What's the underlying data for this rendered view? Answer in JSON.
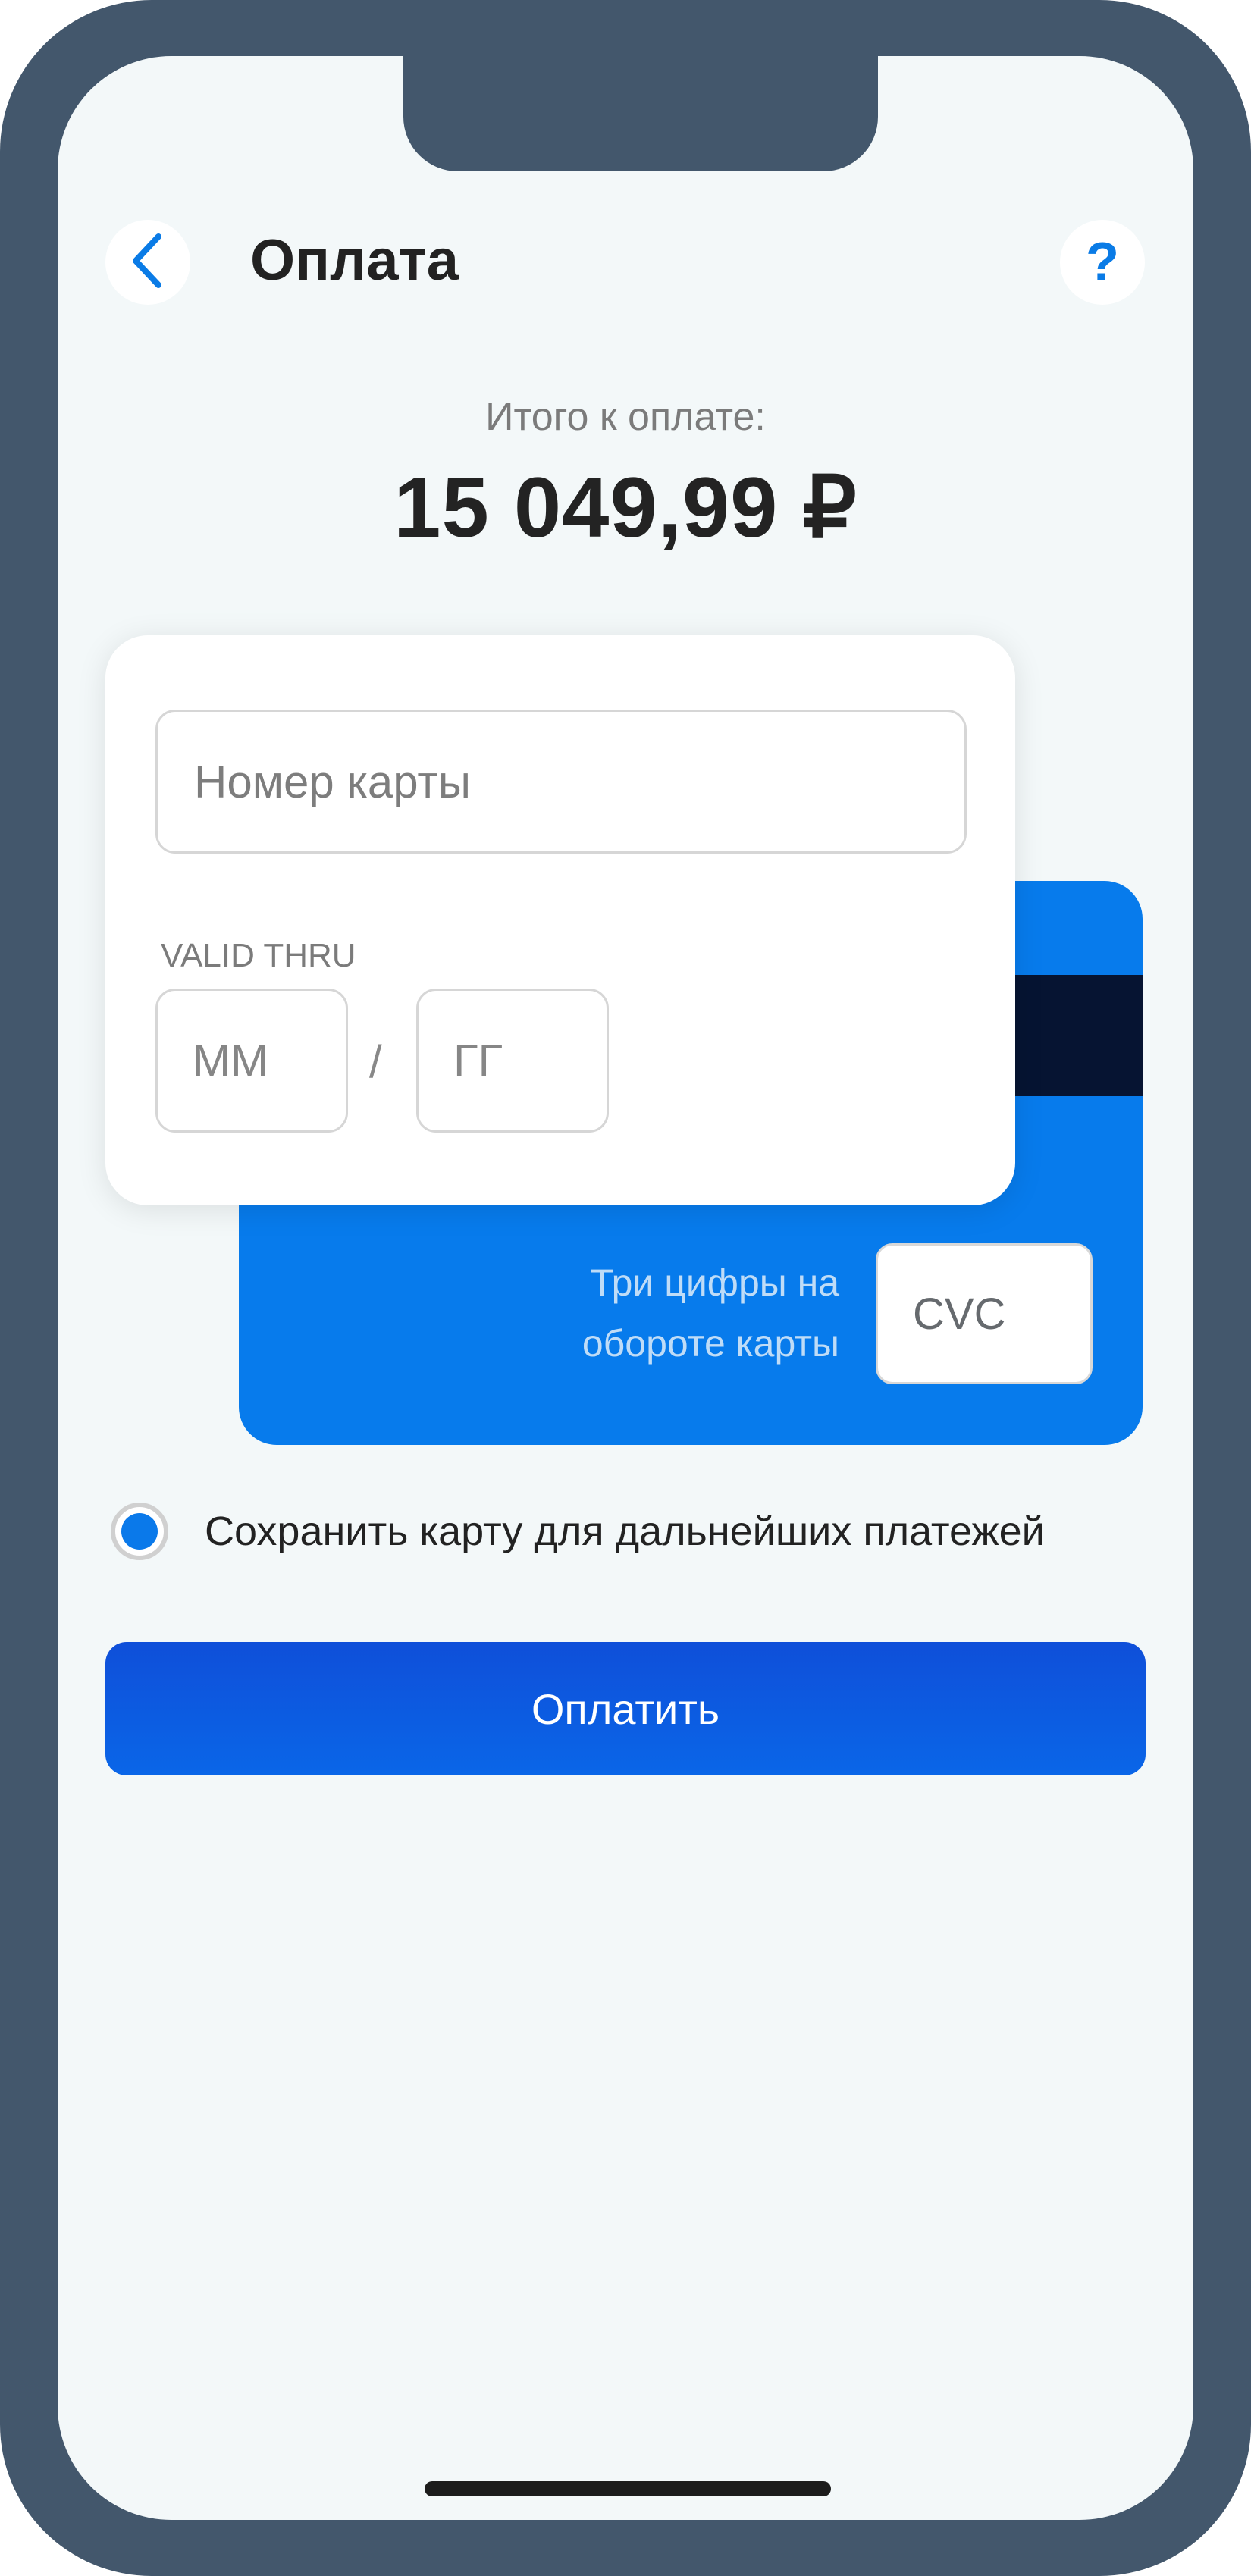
{
  "header": {
    "title": "Оплата",
    "back_icon": "chevron-left-icon",
    "help_icon": "question-mark-icon",
    "help_glyph": "?"
  },
  "total": {
    "label": "Итого к оплате:",
    "amount": "15 049,99 ₽"
  },
  "card_form": {
    "card_number_placeholder": "Номер карты",
    "valid_thru_label": "VALID THRU",
    "month_placeholder": "ММ",
    "year_placeholder": "ГГ",
    "date_separator": "/",
    "cvc_hint_line1": "Три цифры на",
    "cvc_hint_line2": "обороте карты",
    "cvc_placeholder": "CVC"
  },
  "save_card": {
    "label": "Сохранить карту для дальнейших платежей",
    "checked": true
  },
  "pay_button": {
    "label": "Оплатить"
  },
  "colors": {
    "accent": "#0a7be6",
    "card_blue": "#077bec",
    "stripe": "#061432",
    "frame": "#43576c",
    "background": "#f3f8f9"
  }
}
